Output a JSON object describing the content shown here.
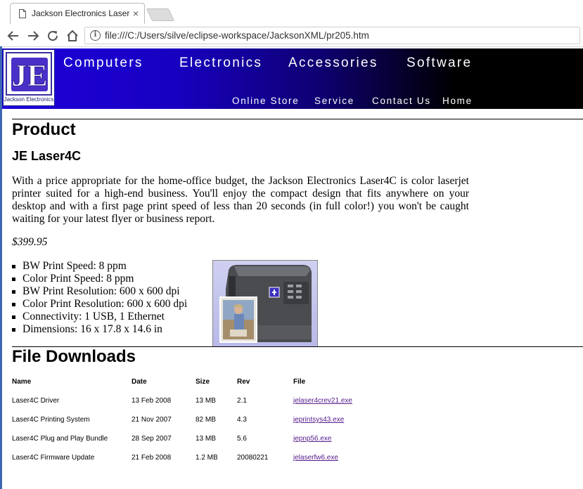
{
  "browser": {
    "tab_title": "Jackson Electronics Laser",
    "tab_close": "×",
    "url": "file:///C:/Users/silve/eclipse-workspace/JacksonXML/pr205.htm",
    "info_glyph": "i",
    "icons": [
      "back-arrow-icon",
      "forward-arrow-icon",
      "reload-icon",
      "home-icon",
      "info-icon",
      "document-icon",
      "close-icon"
    ]
  },
  "site": {
    "logo_text": "Jackson Electronics",
    "logo_mark": "JE",
    "top_nav": [
      "Computers",
      "Electronics",
      "Accessories",
      "Software"
    ],
    "sub_nav": [
      "Online Store",
      "Service",
      "Contact Us",
      "Home"
    ],
    "colors": {
      "banner_start": "#1e00dc",
      "banner_end": "#000000",
      "link_visited": "#551a8b"
    }
  },
  "product": {
    "heading": "Product",
    "name": "JE Laser4C",
    "description": "With a price appropriate for the home-office budget, the Jackson Electronics Laser4C is color laserjet printer suited for a high-end business. You'll enjoy the compact design that fits anywhere on your desktop and with a first page print speed of less than 20 seconds (in full color!) you won't be caught waiting for your latest flyer or business report.",
    "price": "$399.95",
    "specs": [
      "BW Print Speed: 8 ppm",
      "Color Print Speed: 8 ppm",
      "BW Print Resolution: 600 x 600 dpi",
      "Color Print Resolution: 600 x 600 dpi",
      "Connectivity: 1 USB, 1 Ethernet",
      "Dimensions: 16 x 17.8 x 14.6 in"
    ]
  },
  "downloads": {
    "heading": "File Downloads",
    "columns": [
      "Name",
      "Date",
      "Size",
      "Rev",
      "File"
    ],
    "rows": [
      {
        "name": "Laser4C Driver",
        "date": "13 Feb 2008",
        "size": "13 MB",
        "rev": "2.1",
        "file": "jelaser4crev21.exe"
      },
      {
        "name": "Laser4C Printing System",
        "date": "21 Nov 2007",
        "size": "82 MB",
        "rev": "4.3",
        "file": "jeprintsys43.exe"
      },
      {
        "name": "Laser4C Plug and Play Bundle",
        "date": "28 Sep 2007",
        "size": "13 MB",
        "rev": "5.6",
        "file": "jepnp56.exe"
      },
      {
        "name": "Laser4C Firmware Update",
        "date": "21 Feb 2008",
        "size": "1.2 MB",
        "rev": "20080221",
        "file": "jelaserfw6.exe"
      }
    ]
  }
}
